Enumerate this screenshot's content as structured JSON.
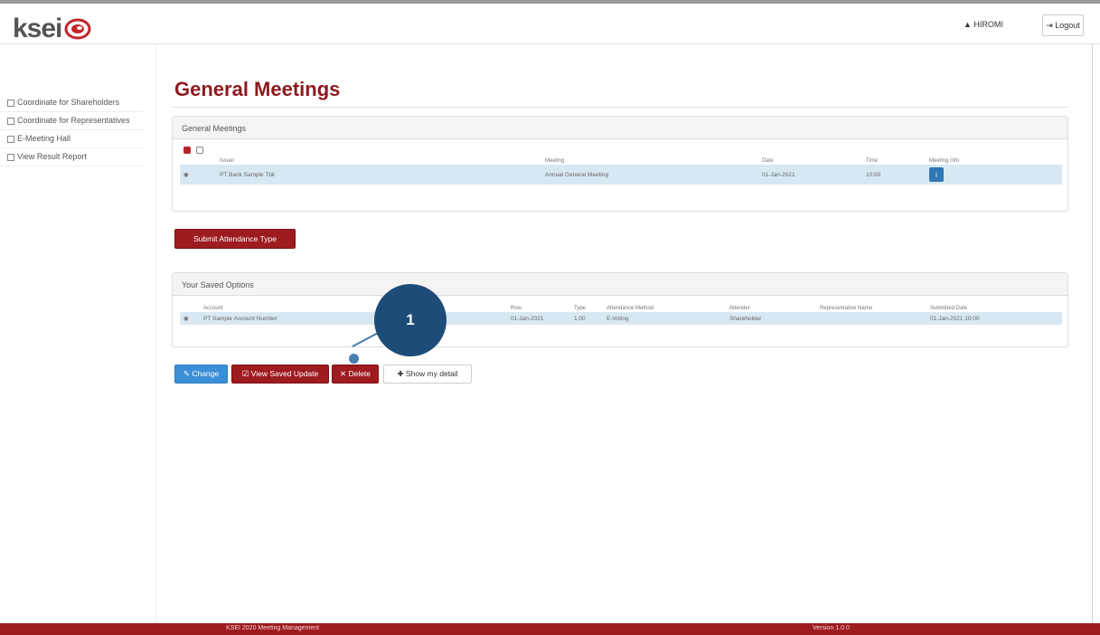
{
  "header": {
    "logo_text": "ksei",
    "user_label": "▲ HIROMI",
    "logout_label": "⇥ Logout"
  },
  "sidebar": {
    "items": [
      {
        "label": "Coordinate for Shareholders"
      },
      {
        "label": "Coordinate for Representatives"
      },
      {
        "label": "E-Meeting Hall"
      },
      {
        "label": "View Result Report"
      }
    ]
  },
  "page": {
    "title": "General Meetings"
  },
  "meetings_panel": {
    "heading": "General Meetings",
    "columns": [
      "Issuer",
      "Meeting",
      "Date",
      "Time",
      "Meeting Info"
    ],
    "rows": [
      {
        "issuer": "PT Bank Sample Tbk",
        "meeting": "Annual General Meeting",
        "date": "01-Jan-2021",
        "time": "10:00",
        "info": "i"
      }
    ]
  },
  "attendance_button": "Submit Attendance Type",
  "vote_panel": {
    "heading": "Your Saved Options",
    "columns": [
      "Account",
      "Row",
      "Type",
      "Attendance Method",
      "Attender",
      "Representative Name",
      "Submitted Date"
    ],
    "rows": [
      {
        "account": "PT Sample Account Number",
        "row": "01-Jan-2021",
        "type": "1,00",
        "method": "E-Voting",
        "attender": "Shareholder",
        "rep": "",
        "submitted": "01-Jan-2021 10:00"
      }
    ]
  },
  "actions": {
    "change": "✎ Change",
    "view_vote": "☑ View Saved Update",
    "delete": "✕ Delete",
    "show_detail": "✚ Show my detail"
  },
  "callout": {
    "number": "1"
  },
  "footer": {
    "left": "KSEI 2020 Meeting Management",
    "right": "Version 1.0.0"
  },
  "colors": {
    "brand_red": "#9e1b1f",
    "title_red": "#8b1a1f",
    "blue": "#3b8fd6",
    "callout": "#1e4c78"
  }
}
